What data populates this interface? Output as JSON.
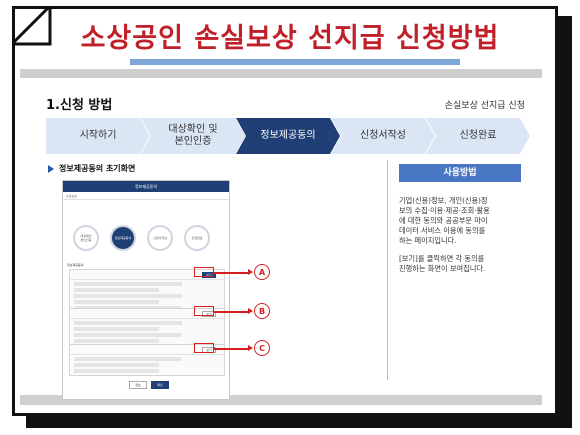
{
  "title": "소상공인 손실보상 선지급 신청방법",
  "section": {
    "heading": "1.신청 방법",
    "right_label": "손실보상 선지급 신청"
  },
  "steps": [
    {
      "label": "시작하기",
      "active": false
    },
    {
      "label": "대상확인 및\n본인인증",
      "active": false
    },
    {
      "label": "정보제공동의",
      "active": true
    },
    {
      "label": "신청서작성",
      "active": false
    },
    {
      "label": "신청완료",
      "active": false
    }
  ],
  "sub_label": "정보제공동의 초기화면",
  "mock": {
    "header": "정보제공동의",
    "subheader": "손실보상",
    "circles": [
      "대상확인\n본인인증",
      "정보제공동의",
      "신청서작성",
      "신청완료"
    ],
    "note": "정보제공동의",
    "view_label": "보기",
    "buttons": [
      "취소",
      "확인"
    ]
  },
  "markers": [
    "A",
    "B",
    "C"
  ],
  "panel": {
    "header": "사용방법",
    "para1": "기업(신용)정보, 개인(신용)정\n보의 수집·이용·제공·조회·활용\n에 대한 동의와 공공부문 마이\n데이터 서비스 이용에 동의를\n하는 페이지입니다.",
    "para2": "[보기]를 클릭하면 각 동의를\n진행하는 화면이 보여집니다."
  },
  "colors": {
    "title": "#c0202a",
    "accent": "#4a77c3",
    "active_step": "#1f3f76",
    "highlight": "#d42020"
  }
}
